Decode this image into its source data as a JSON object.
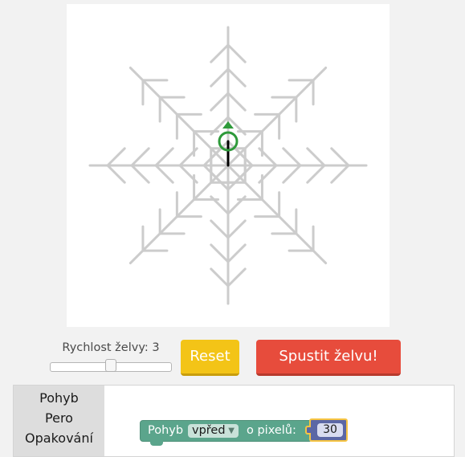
{
  "canvas": {
    "background": "#ffffff",
    "snowflake_color": "#cccccc",
    "turtle_color": "#2e9a3a",
    "turtle_line_color": "#000000"
  },
  "speed": {
    "label": "Rychlost želvy: 3",
    "fraction": 0.5
  },
  "buttons": {
    "reset": "Reset",
    "run": "Spustit želvu!"
  },
  "toolbox": {
    "categories": [
      "Pohyb",
      "Pero",
      "Opakování"
    ]
  },
  "block": {
    "category": "Pohyb",
    "direction": "vpřed",
    "label": "o pixelů:",
    "value": "30"
  }
}
